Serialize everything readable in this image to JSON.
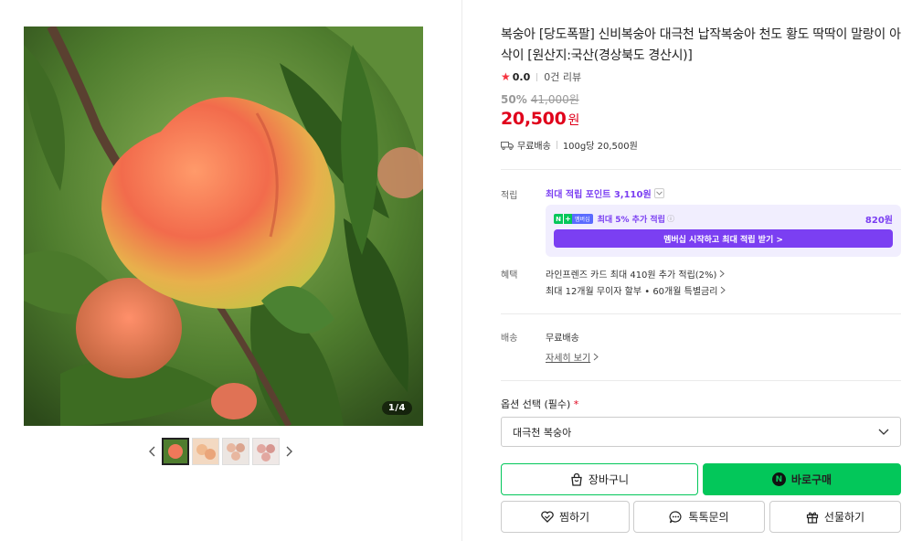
{
  "gallery": {
    "counter": "1/4",
    "prev_icon": "chevron-left-icon",
    "next_icon": "chevron-right-icon",
    "thumbnail_count": 4,
    "active_thumbnail": 1
  },
  "product": {
    "title": "복숭아 [당도폭팔] 신비복숭아 대극천 납작복숭아 천도 황도 딱딱이 말랑이 아삭이 [원산지:국산(경상북도 경산시)]",
    "rating_score": "0.0",
    "review_count": "0건 리뷰",
    "discount_percent": "50%",
    "original_price": "41,000원",
    "price": "20,500",
    "price_unit": "원",
    "shipping": "무료배송",
    "unit_price": "100g당 20,500원"
  },
  "points": {
    "label": "적립",
    "max_points": "최대 적립 포인트 3,110원",
    "membership_logo_text": "멤버십",
    "membership_extra": "최대 5% 추가 적립",
    "membership_amount": "820원",
    "membership_cta": "멤버십 시작하고 최대 적립 받기 >"
  },
  "benefits": {
    "label": "혜택",
    "line1": "라인프렌즈 카드 최대 410원 추가 적립(2%)",
    "line2": "최대 12개월 무이자 할부 • 60개월 특별금리"
  },
  "delivery": {
    "label": "배송",
    "value": "무료배송",
    "detail_link": "자세히 보기"
  },
  "options": {
    "label": "옵션 선택 (필수)",
    "required_mark": "*",
    "selected": "대극천 복숭아"
  },
  "actions": {
    "cart": "장바구니",
    "buy_now": "바로구매",
    "wish": "찜하기",
    "talk": "톡톡문의",
    "gift": "선물하기"
  },
  "colors": {
    "price_red": "#e0001b",
    "naver_green": "#03c75a",
    "membership_purple": "#7b3ff2"
  }
}
